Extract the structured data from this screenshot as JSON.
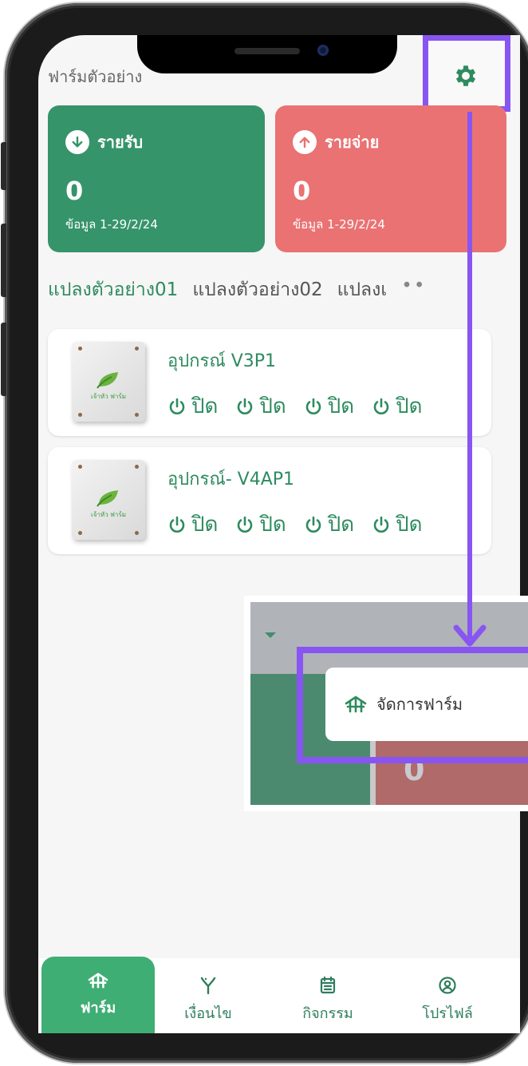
{
  "header": {
    "farm_name": "ฟาร์มตัวอย่าง"
  },
  "cards": [
    {
      "label": "รายรับ",
      "amount": "0",
      "date_range": "ข้อมูล 1-29/2/24",
      "color": "#36946a"
    },
    {
      "label": "รายจ่าย",
      "amount": "0",
      "date_range": "ข้อมูล 1-29/2/24",
      "color": "#ea7272"
    }
  ],
  "plots": [
    "แปลงตัวอย่าง01",
    "แปลงตัวอย่าง02",
    "แปลงเ"
  ],
  "plots_more": "••",
  "devices": [
    {
      "name": "อุปกรณ์ V3P1",
      "brand": "เจ้าหัว ฟาร์ม",
      "switches": [
        "ปิด",
        "ปิด",
        "ปิด",
        "ปิด"
      ]
    },
    {
      "name": "อุปกรณ์- V4AP1",
      "brand": "เจ้าหัว ฟาร์ม",
      "switches": [
        "ปิด",
        "ปิด",
        "ปิด",
        "ปิด"
      ]
    }
  ],
  "popup": {
    "menu_item": "จัดการฟาร์ม",
    "bg_value": "0"
  },
  "nav": [
    {
      "label": "ฟาร์ม",
      "icon": "farm-icon"
    },
    {
      "label": "เงื่อนไข",
      "icon": "branch-icon"
    },
    {
      "label": "กิจกรรม",
      "icon": "calendar-icon"
    },
    {
      "label": "โปรไฟล์",
      "icon": "profile-icon"
    }
  ],
  "colors": {
    "primary": "#2e8b5f",
    "highlight": "#8855f2",
    "income": "#36946a",
    "expense": "#ea7272"
  }
}
